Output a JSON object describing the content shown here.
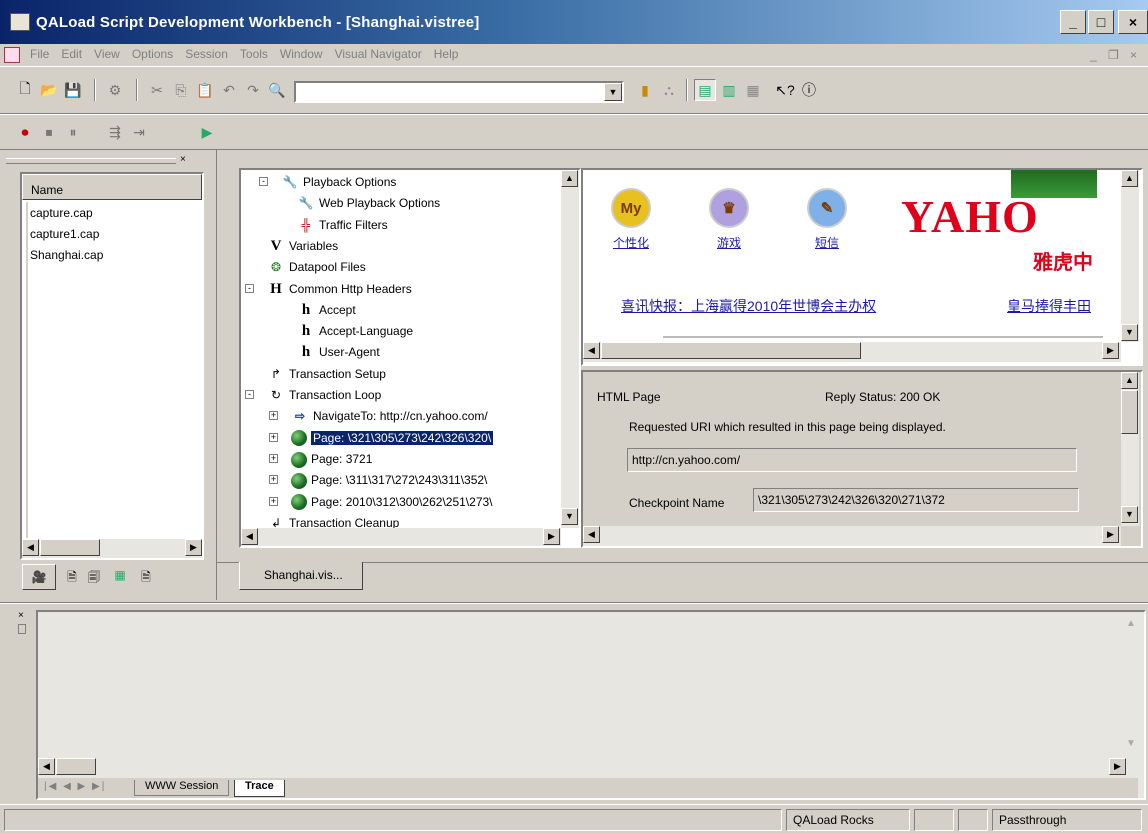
{
  "window": {
    "title": "QALoad Script Development Workbench - [Shanghai.vistree]",
    "min_glyph": "_",
    "max_glyph": "□",
    "close_glyph": "×"
  },
  "menu": [
    "File",
    "Edit",
    "View",
    "Options",
    "Session",
    "Tools",
    "Window",
    "Visual Navigator",
    "Help"
  ],
  "mdi_controls": {
    "min": "_",
    "restore": "❐",
    "close": "×"
  },
  "toolbar": {
    "combo_value": ""
  },
  "file_panel": {
    "header": "Name",
    "items": [
      "capture.cap",
      "capture1.cap",
      "Shanghai.cap"
    ]
  },
  "tree": {
    "items": [
      {
        "label": "Playback Options"
      },
      {
        "label": "Web Playback Options"
      },
      {
        "label": "Traffic Filters"
      },
      {
        "label": "Variables"
      },
      {
        "label": "Datapool Files"
      },
      {
        "label": "Common Http Headers"
      },
      {
        "label": "Accept"
      },
      {
        "label": "Accept-Language"
      },
      {
        "label": "User-Agent"
      },
      {
        "label": "Transaction Setup"
      },
      {
        "label": "Transaction Loop"
      },
      {
        "label": "NavigateTo: http://cn.yahoo.com/"
      },
      {
        "label": "Page: \\321\\305\\273\\242\\326\\320\\"
      },
      {
        "label": "Page: 3721"
      },
      {
        "label": "Page: \\311\\317\\272\\243\\311\\352\\"
      },
      {
        "label": "Page: 2010\\312\\300\\262\\251\\273\\"
      },
      {
        "label": "Transaction Cleanup"
      }
    ]
  },
  "browser": {
    "icons": [
      {
        "badge": "My",
        "label": "个性化"
      },
      {
        "badge": "♛",
        "label": "游戏"
      },
      {
        "badge": "✎",
        "label": "短信"
      }
    ],
    "logo": "YAHO",
    "logo_sub": "雅虎中",
    "news1": "喜讯快报：上海赢得2010年世博会主办权",
    "news2": "皇马捧得丰田"
  },
  "details": {
    "html_page": "HTML Page",
    "reply_status": "Reply Status:  200  OK",
    "requested_uri_label": "Requested URI which resulted in this page being displayed.",
    "uri_value": "http://cn.yahoo.com/",
    "checkpoint_label": "Checkpoint Name",
    "checkpoint_value": "\\321\\305\\273\\242\\326\\320\\271\\372"
  },
  "doc_tab": "Shanghai.vis...",
  "bottom_tabs": [
    "WWW Session",
    "Trace"
  ],
  "status": {
    "cell1": "QALoad Rocks",
    "cell2": "",
    "cell3": "Passthrough"
  },
  "colors": {
    "selection": "#0a246a",
    "title_start": "#0a246a",
    "title_end": "#a6caf0",
    "yahoo_red": "#e0001b",
    "link_blue": "#1a1aaa"
  }
}
